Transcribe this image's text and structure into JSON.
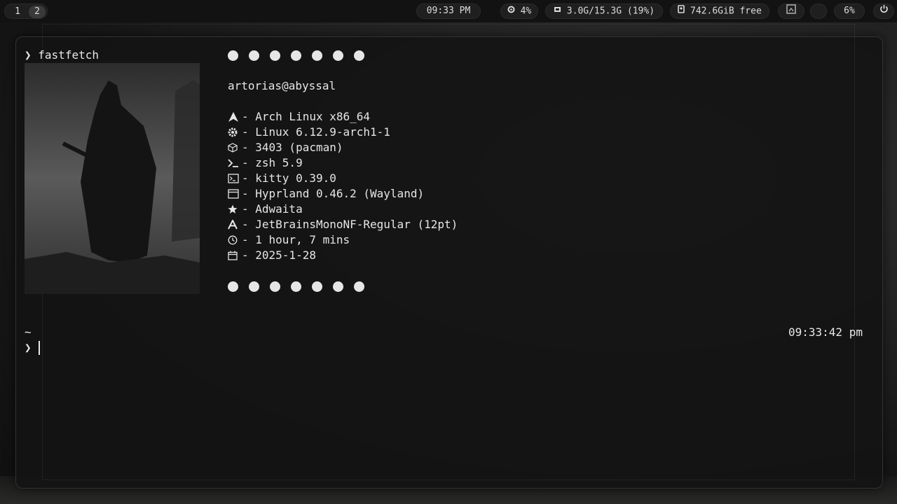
{
  "topbar": {
    "workspaces": [
      "1",
      "2"
    ],
    "clock": "09:33 PM",
    "cpu": "4%",
    "memory": "3.0G/15.3G (19%)",
    "disk": "742.6GiB free",
    "volume": "6%"
  },
  "terminal": {
    "prompt_symbol": "❯",
    "command": "fastfetch",
    "user_host": "artorias@abyssal",
    "info": [
      {
        "icon": "arch-logo-icon",
        "text": "- Arch Linux x86_64"
      },
      {
        "icon": "gear-icon",
        "text": "- Linux 6.12.9-arch1-1"
      },
      {
        "icon": "package-icon",
        "text": "- 3403 (pacman)"
      },
      {
        "icon": "shell-icon",
        "text": "- zsh 5.9"
      },
      {
        "icon": "terminal-icon",
        "text": "- kitty 0.39.0"
      },
      {
        "icon": "window-icon",
        "text": "- Hyprland 0.46.2 (Wayland)"
      },
      {
        "icon": "star-icon",
        "text": "- Adwaita"
      },
      {
        "icon": "font-icon",
        "text": "- JetBrainsMonoNF-Regular (12pt)"
      },
      {
        "icon": "clock-icon",
        "text": "- 1 hour, 7 mins"
      },
      {
        "icon": "calendar-icon",
        "text": "- 2025-1-28"
      }
    ],
    "cwd": "~",
    "right_prompt_time": "09:33:42 pm"
  },
  "colors": {
    "bar_bg": "#121212",
    "pill_bg": "#1f1f1f",
    "text": "#e6e6e6",
    "terminal_bg": "#141414"
  }
}
